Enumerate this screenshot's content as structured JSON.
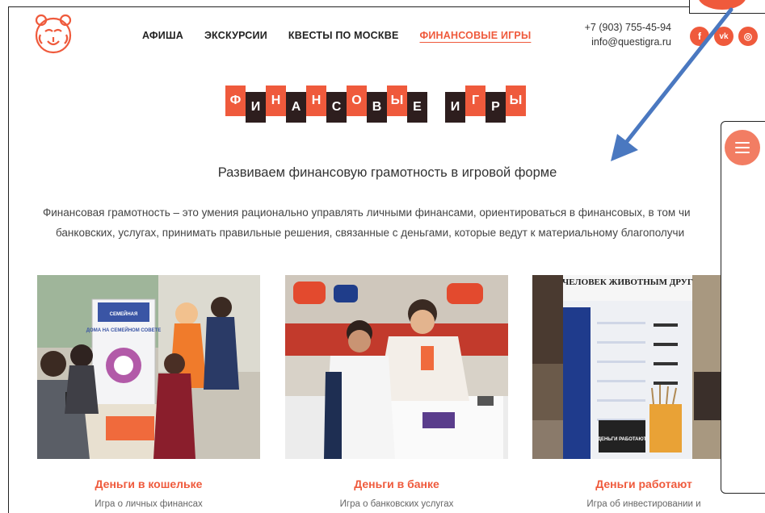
{
  "header": {
    "nav": [
      {
        "label": "АФИША"
      },
      {
        "label": "ЭКСКУРСИИ"
      },
      {
        "label": "КВЕСТЫ ПО МОСКВЕ"
      },
      {
        "label": "ФИНАНСОВЫЕ ИГРЫ",
        "active": true
      }
    ],
    "phone": "+7 (903) 755-45-94",
    "email": "info@questigra.ru",
    "socials": [
      {
        "icon": "facebook-icon",
        "glyph": "f"
      },
      {
        "icon": "vk-icon",
        "glyph": "vk"
      },
      {
        "icon": "odnoklassniki-icon",
        "glyph": "◎"
      }
    ]
  },
  "hero": {
    "title_letters": [
      "Ф",
      "И",
      "Н",
      "А",
      "Н",
      "С",
      "О",
      "В",
      "Ы",
      "Е",
      "",
      "И",
      "Г",
      "Р",
      "Ы"
    ],
    "subtitle": "Развиваем финансовую грамотность в игровой форме",
    "intro_line1": "Финансовая грамотность – это умения рационально управлять личными финансами, ориентироваться в финансовых, в том чи",
    "intro_line2": "банковских, услугах, принимать правильные решения, связанные с деньгами, которые ведут к материальному благополучи"
  },
  "cards": [
    {
      "title": "Деньги в кошельке",
      "desc": "Игра о личных финансах",
      "poster_heading": "ДОМА НА СЕМЕЙНОМ СОВЕТЕ"
    },
    {
      "title": "Деньги в банке",
      "desc": "Игра о банковских услугах"
    },
    {
      "title": "Деньги работают",
      "desc": "Игра об инвестировании и",
      "poster_heading": "ЧЕЛОВЕК ЖИВОТНЫМ ДРУГ",
      "sign_text": "ДЕНЬГИ РАБОТАЮТ"
    }
  ],
  "colors": {
    "accent": "#ef5a3c",
    "dark": "#2e1e1e",
    "arrow": "#4a78c0"
  }
}
